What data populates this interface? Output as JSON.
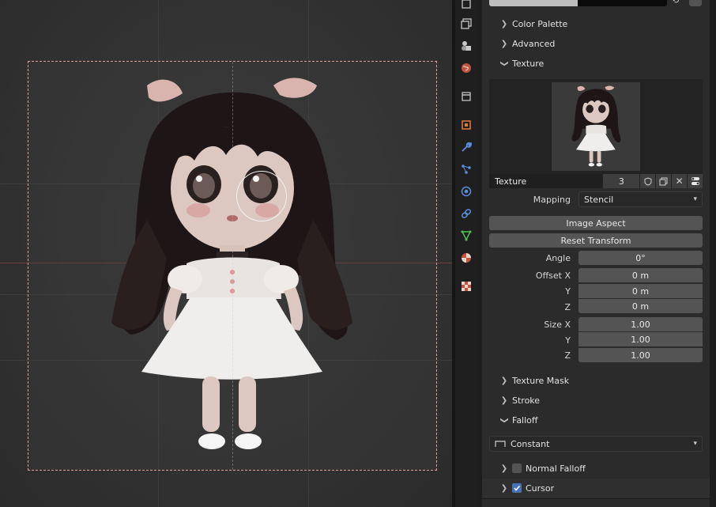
{
  "panels": {
    "color_palette": "Color Palette",
    "advanced": "Advanced",
    "texture": "Texture",
    "texture_mask": "Texture Mask",
    "stroke": "Stroke",
    "falloff": "Falloff"
  },
  "texture_block": {
    "name": "Texture",
    "users": "3",
    "mapping_label": "Mapping",
    "mapping_value": "Stencil",
    "image_aspect_label": "Image Aspect",
    "reset_transform_label": "Reset Transform",
    "angle_label": "Angle",
    "angle_value": "0°",
    "offset_x_label": "Offset X",
    "offset_x_value": "0 m",
    "offset_y_label": "Y",
    "offset_y_value": "0 m",
    "offset_z_label": "Z",
    "offset_z_value": "0 m",
    "size_x_label": "Size X",
    "size_x_value": "1.00",
    "size_y_label": "Y",
    "size_y_value": "1.00",
    "size_z_label": "Z",
    "size_z_value": "1.00"
  },
  "falloff_block": {
    "curve_preset": "Constant",
    "normal_falloff_label": "Normal Falloff",
    "normal_falloff_checked": false,
    "cursor_label": "Cursor",
    "cursor_checked": true
  },
  "icons": {
    "tabs": [
      "tool-icon",
      "render-icon",
      "output-icon",
      "view-layer-icon",
      "scene-icon",
      "world-icon",
      "collection-icon",
      "object-icon",
      "modifier-icon",
      "particles-icon",
      "physics-icon",
      "constraints-icon",
      "data-icon",
      "material-icon",
      "texture-icon"
    ]
  },
  "colors": {
    "accent": "#4772b3",
    "stencil_border": "#d8a097"
  }
}
